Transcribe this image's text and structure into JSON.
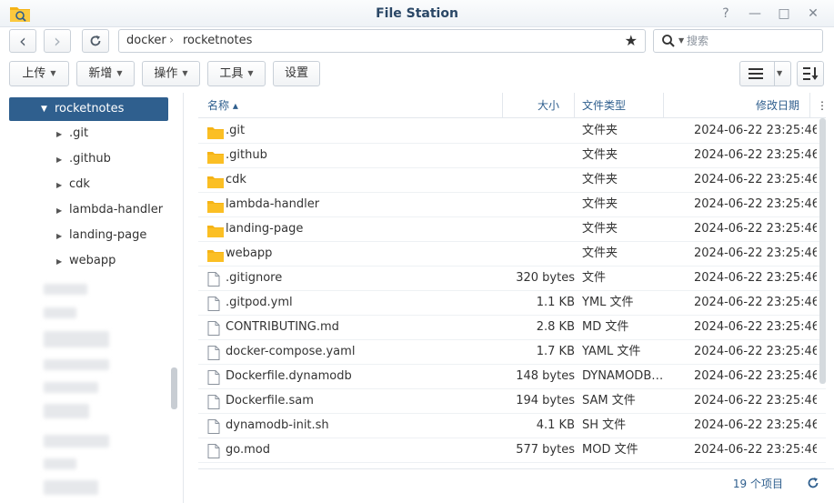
{
  "window": {
    "title": "File Station",
    "help": "?",
    "minimize": "—",
    "maximize": "□",
    "close": "✕"
  },
  "nav": {
    "back": "‹",
    "forward": "›",
    "path": [
      "docker",
      "rocketnotes"
    ],
    "path_sep": "›",
    "star": "★",
    "search_placeholder": "搜索"
  },
  "toolbar": {
    "upload": "上传",
    "create": "新增",
    "action": "操作",
    "tools": "工具",
    "settings": "设置"
  },
  "sidebar": {
    "root": "rocketnotes",
    "items": [
      ".git",
      ".github",
      "cdk",
      "lambda-handler",
      "landing-page",
      "webapp"
    ]
  },
  "columns": {
    "name": "名称 ▴",
    "size": "大小",
    "type": "文件类型",
    "date": "修改日期",
    "more": "⋮"
  },
  "files": [
    {
      "name": ".git",
      "size": "",
      "type": "文件夹",
      "date": "2024-06-22 23:25:46",
      "icon": "folder-icon"
    },
    {
      "name": ".github",
      "size": "",
      "type": "文件夹",
      "date": "2024-06-22 23:25:46",
      "icon": "folder-icon"
    },
    {
      "name": "cdk",
      "size": "",
      "type": "文件夹",
      "date": "2024-06-22 23:25:46",
      "icon": "folder-icon"
    },
    {
      "name": "lambda-handler",
      "size": "",
      "type": "文件夹",
      "date": "2024-06-22 23:25:46",
      "icon": "folder-icon"
    },
    {
      "name": "landing-page",
      "size": "",
      "type": "文件夹",
      "date": "2024-06-22 23:25:46",
      "icon": "folder-icon"
    },
    {
      "name": "webapp",
      "size": "",
      "type": "文件夹",
      "date": "2024-06-22 23:25:46",
      "icon": "folder-icon"
    },
    {
      "name": ".gitignore",
      "size": "320 bytes",
      "type": "文件",
      "date": "2024-06-22 23:25:46",
      "icon": "file-icon"
    },
    {
      "name": ".gitpod.yml",
      "size": "1.1 KB",
      "type": "YML 文件",
      "date": "2024-06-22 23:25:46",
      "icon": "file-icon"
    },
    {
      "name": "CONTRIBUTING.md",
      "size": "2.8 KB",
      "type": "MD 文件",
      "date": "2024-06-22 23:25:46",
      "icon": "file-icon"
    },
    {
      "name": "docker-compose.yaml",
      "size": "1.7 KB",
      "type": "YAML 文件",
      "date": "2024-06-22 23:25:46",
      "icon": "file-icon"
    },
    {
      "name": "Dockerfile.dynamodb",
      "size": "148 bytes",
      "type": "DYNAMODB …",
      "date": "2024-06-22 23:25:46",
      "icon": "file-icon"
    },
    {
      "name": "Dockerfile.sam",
      "size": "194 bytes",
      "type": "SAM 文件",
      "date": "2024-06-22 23:25:46",
      "icon": "file-icon"
    },
    {
      "name": "dynamodb-init.sh",
      "size": "4.1 KB",
      "type": "SH 文件",
      "date": "2024-06-22 23:25:46",
      "icon": "file-icon"
    },
    {
      "name": "go.mod",
      "size": "577 bytes",
      "type": "MOD 文件",
      "date": "2024-06-22 23:25:46",
      "icon": "file-icon"
    }
  ],
  "status": {
    "count": "19 个项目"
  },
  "colors": {
    "accent": "#2f5f8e",
    "folder": "#f5b316",
    "title": "#2a4766"
  }
}
